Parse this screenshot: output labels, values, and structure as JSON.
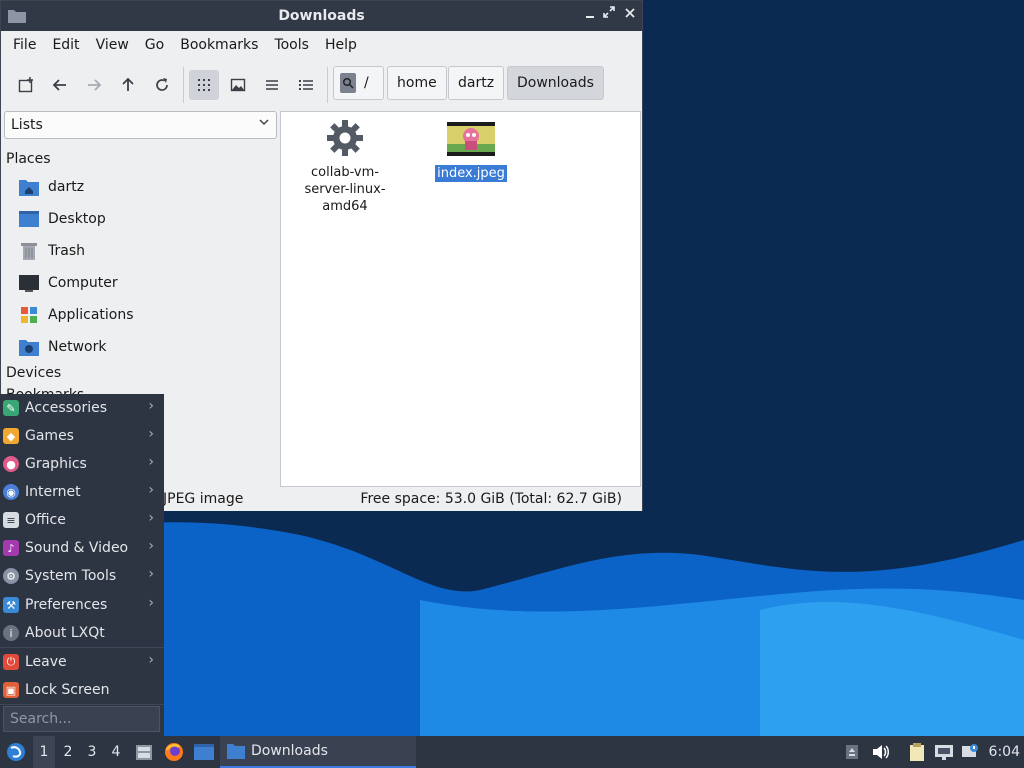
{
  "window": {
    "title": "Downloads",
    "menu": [
      "File",
      "Edit",
      "View",
      "Go",
      "Bookmarks",
      "Tools",
      "Help"
    ],
    "path": {
      "root": "/",
      "crumbs": [
        "home",
        "dartz",
        "Downloads"
      ]
    },
    "sidebar": {
      "mode": "Lists",
      "places_heading": "Places",
      "places": [
        "dartz",
        "Desktop",
        "Trash",
        "Computer",
        "Applications",
        "Network"
      ],
      "devices_heading": "Devices",
      "bookmarks_heading": "Bookmarks"
    },
    "files": [
      {
        "name_lines": [
          "collab-vm-",
          "server-linux-",
          "amd64"
        ],
        "icon": "gear-icon",
        "selected": false
      },
      {
        "name_lines": [
          "index.jpeg"
        ],
        "icon": "image-thumbnail",
        "selected": true
      }
    ],
    "status": {
      "selection": "JPEG image",
      "free_space": "Free space: 53.0 GiB (Total: 62.7 GiB)"
    }
  },
  "app_menu": {
    "items": [
      {
        "label": "Accessories",
        "submenu": true,
        "color": "#3aa676"
      },
      {
        "label": "Games",
        "submenu": true,
        "color": "#f0a830"
      },
      {
        "label": "Graphics",
        "submenu": true,
        "color": "#e05a8a"
      },
      {
        "label": "Internet",
        "submenu": true,
        "color": "#4a7fd9"
      },
      {
        "label": "Office",
        "submenu": true,
        "color": "#d7dbe2"
      },
      {
        "label": "Sound & Video",
        "submenu": true,
        "color": "#a33ab0"
      },
      {
        "label": "System Tools",
        "submenu": true,
        "color": "#8a93a3"
      },
      {
        "label": "Preferences",
        "submenu": true,
        "color": "#3a8ad6"
      },
      {
        "label": "About LXQt",
        "submenu": false,
        "color": "#6b7280"
      },
      {
        "label": "Leave",
        "submenu": true,
        "color": "#e04a3a"
      },
      {
        "label": "Lock Screen",
        "submenu": false,
        "color": "#e0603a"
      }
    ],
    "search_placeholder": "Search..."
  },
  "taskbar": {
    "workspaces": [
      "1",
      "2",
      "3",
      "4"
    ],
    "task_label": "Downloads",
    "clock": "6:04"
  }
}
